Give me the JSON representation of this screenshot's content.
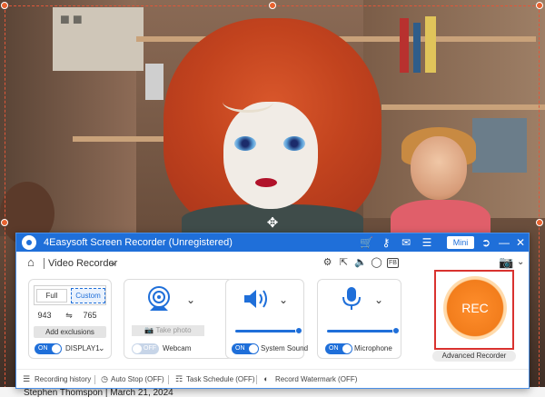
{
  "caption": {
    "text": "Stephen Thomspon | March 21, 2024"
  },
  "recorder": {
    "title": "4Easysoft Screen Recorder (Unregistered)",
    "titlebar_icons": [
      "cart-icon",
      "key-icon",
      "chat-icon",
      "menu-icon",
      "pin-icon",
      "minimize-icon",
      "close-icon"
    ],
    "mini_label": "Mini",
    "mode_label": "Video Recorder",
    "subbar_icons": [
      "gear-icon",
      "export-icon",
      "volume-icon",
      "mouse-icon",
      "fn-icon",
      "camera-icon"
    ],
    "region": {
      "full_label": "Full",
      "custom_label": "Custom",
      "width": "943",
      "height": "765",
      "add_exclusions_label": "Add exclusions",
      "toggle_state": "ON",
      "display_label": "DISPLAY1"
    },
    "webcam": {
      "take_photo_label": "Take photo",
      "toggle_state": "OFF",
      "label": "Webcam"
    },
    "system_sound": {
      "toggle_state": "ON",
      "label": "System Sound",
      "volume": 1.0
    },
    "microphone": {
      "toggle_state": "ON",
      "label": "Microphone",
      "volume": 1.0
    },
    "rec_label": "REC",
    "advanced_recorder_label": "Advanced Recorder",
    "bottom": {
      "recording_history": "Recording history",
      "auto_stop": "Auto Stop (OFF)",
      "task_schedule": "Task Schedule (OFF)",
      "record_watermark": "Record Watermark (OFF)"
    },
    "accent_color": "#1f6fd9",
    "rec_color": "#f27d1c"
  }
}
